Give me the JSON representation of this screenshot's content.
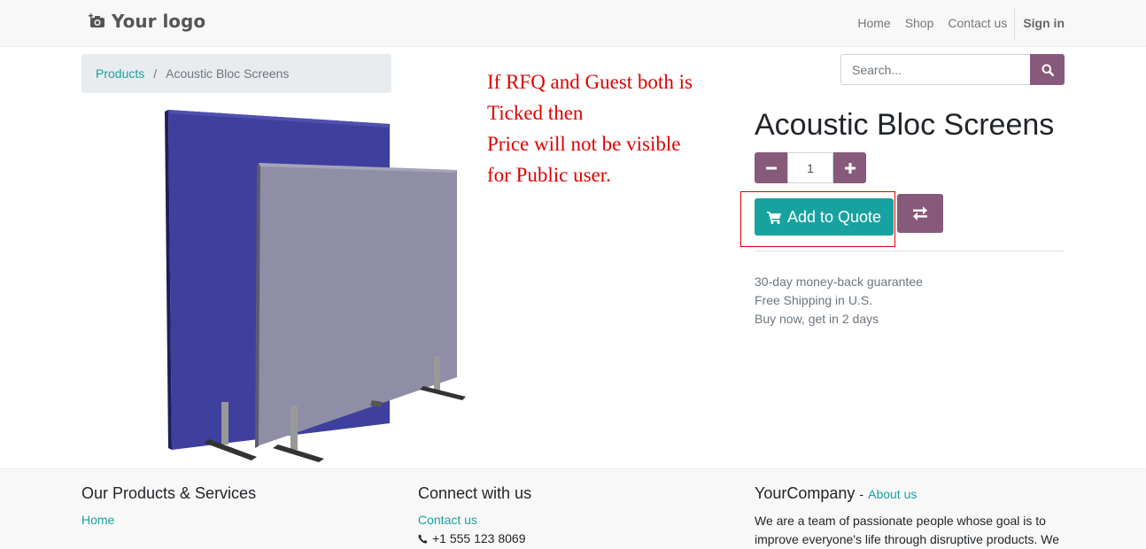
{
  "header": {
    "logo_text": "Your logo",
    "nav": {
      "home": "Home",
      "shop": "Shop",
      "contact": "Contact us",
      "signin": "Sign in"
    }
  },
  "breadcrumb": {
    "link": "Products",
    "separator": "/",
    "current": "Acoustic Bloc Screens"
  },
  "search": {
    "placeholder": "Search..."
  },
  "annotation": {
    "lines": [
      "If RFQ and Guest both is",
      "Ticked then",
      "Price will not be visible",
      "for Public user."
    ]
  },
  "product": {
    "title": "Acoustic Bloc Screens",
    "quantity": "1",
    "add_to_quote": "Add to Quote",
    "perks": [
      "30-day money-back guarantee",
      "Free Shipping in U.S.",
      "Buy now, get in 2 days"
    ]
  },
  "footer": {
    "col1": {
      "heading": "Our Products & Services",
      "link": "Home"
    },
    "col2": {
      "heading": "Connect with us",
      "link": "Contact us",
      "phone": "+1 555 123 8069"
    },
    "col3": {
      "heading": "YourCompany",
      "separator": "-",
      "about_link": "About us",
      "text": "We are a team of passionate people whose goal is to improve everyone's life through disruptive products. We"
    }
  },
  "colors": {
    "primary": "#875a7b",
    "accent": "#17a2a0",
    "annotation": "#e00000"
  }
}
